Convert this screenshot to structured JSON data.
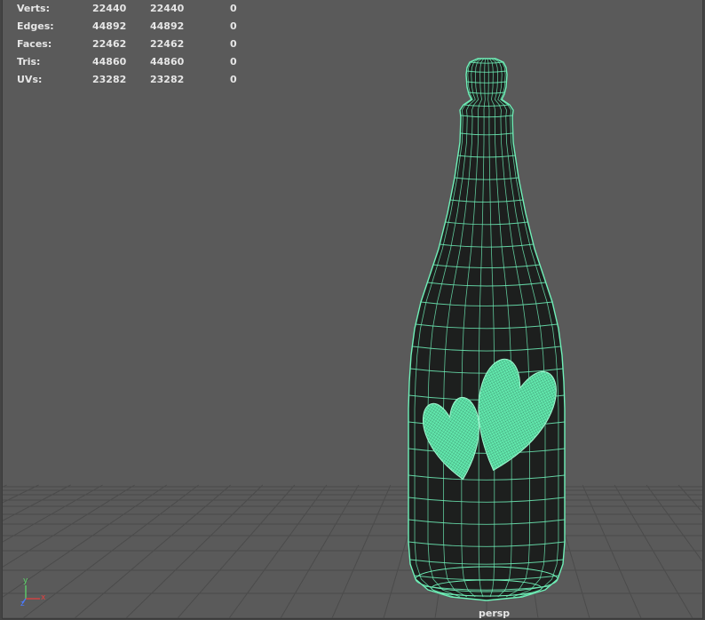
{
  "hud": {
    "rows": [
      {
        "label": "Verts:",
        "v1": "22440",
        "v2": "22440",
        "v3": "0"
      },
      {
        "label": "Edges:",
        "v1": "44892",
        "v2": "44892",
        "v3": "0"
      },
      {
        "label": "Faces:",
        "v1": "22462",
        "v2": "22462",
        "v3": "0"
      },
      {
        "label": "Tris:",
        "v1": "44860",
        "v2": "44860",
        "v3": "0"
      },
      {
        "label": "UVs:",
        "v1": "23282",
        "v2": "23282",
        "v3": "0"
      }
    ]
  },
  "camera": {
    "name": "persp"
  },
  "axis": {
    "y_label": "y",
    "x_label": "x",
    "z_label": "z"
  },
  "colors": {
    "viewport_bg": "#5a5a5a",
    "grid": "#4b4b4b",
    "wire": "#6ff0b8",
    "bottle_fill": "#1d1f1e",
    "heart_fill": "#62e8ad",
    "hud_text": "#e6e6e6",
    "axis_x": "#e04040",
    "axis_y": "#5cd86a",
    "axis_z": "#4b7bff"
  },
  "icons": {
    "axis": "axis-gizmo-icon",
    "grid": "ground-grid"
  }
}
